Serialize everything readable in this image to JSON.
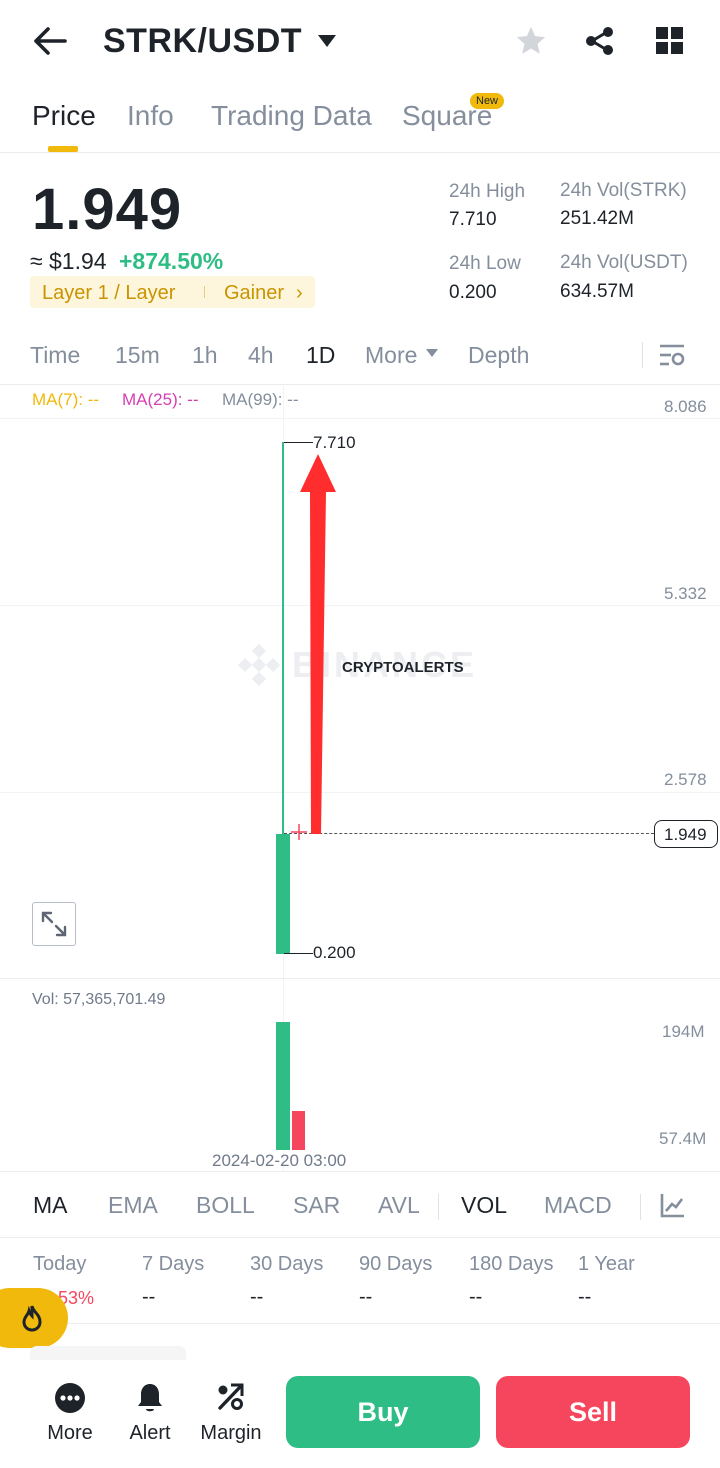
{
  "header": {
    "title": "STRK/USDT"
  },
  "tabs": [
    {
      "label": "Price"
    },
    {
      "label": "Info"
    },
    {
      "label": "Trading Data"
    },
    {
      "label": "Square"
    }
  ],
  "new_badge": "New",
  "price": {
    "last": "1.949",
    "usd_approx": "≈ $1.94",
    "change": "+874.50%",
    "tag_category": "Layer 1 / Layer",
    "tag_status": "Gainer",
    "chevron": "›"
  },
  "stats": {
    "high_label": "24h High",
    "high": "7.710",
    "low_label": "24h Low",
    "low": "0.200",
    "vol_base_label": "24h Vol(STRK)",
    "vol_base": "251.42M",
    "vol_quote_label": "24h Vol(USDT)",
    "vol_quote": "634.57M"
  },
  "intervals": [
    {
      "label": "Time"
    },
    {
      "label": "15m"
    },
    {
      "label": "1h"
    },
    {
      "label": "4h"
    },
    {
      "label": "1D"
    },
    {
      "label": "More"
    },
    {
      "label": "Depth"
    }
  ],
  "ma": {
    "ma7": "MA(7): --",
    "ma25": "MA(25): --",
    "ma99": "MA(99): --"
  },
  "chart": {
    "watermark": "BINANCE",
    "overlay_text": "CRYPTOALERTS",
    "high_label": "7.710",
    "low_label": "0.200",
    "current_label": "1.949",
    "vol_label": "Vol: 57,365,701.49",
    "date_label": "2024-02-20 03:00",
    "price_axis": [
      "8.086",
      "5.332",
      "2.578"
    ],
    "vol_axis": [
      "194M",
      "57.4M"
    ]
  },
  "chart_data": {
    "type": "candlestick",
    "x": [
      "2024-02-20 03:00"
    ],
    "open": 0.2,
    "high": 7.71,
    "low": 0.2,
    "close": 1.949,
    "price_ticks": [
      8.086,
      5.332,
      2.578
    ],
    "volume": [
      {
        "name": "green bar",
        "value": 194000000
      },
      {
        "name": "red bar",
        "value": 57400000
      }
    ],
    "volume_ticks": [
      "194M",
      "57.4M"
    ],
    "colors": {
      "up": "#2ebd85",
      "down": "#f6465d",
      "arrow": "#ff2d2d"
    }
  },
  "indicators": [
    {
      "label": "MA"
    },
    {
      "label": "EMA"
    },
    {
      "label": "BOLL"
    },
    {
      "label": "SAR"
    },
    {
      "label": "AVL"
    },
    {
      "label": "VOL"
    },
    {
      "label": "MACD"
    }
  ],
  "periods": [
    {
      "label": "Today",
      "value": "53%"
    },
    {
      "label": "7 Days",
      "value": "--"
    },
    {
      "label": "30 Days",
      "value": "--"
    },
    {
      "label": "90 Days",
      "value": "--"
    },
    {
      "label": "180 Days",
      "value": "--"
    },
    {
      "label": "1 Year",
      "value": "--"
    }
  ],
  "bottom": {
    "more": "More",
    "alert": "Alert",
    "margin": "Margin",
    "buy": "Buy",
    "sell": "Sell"
  },
  "colors": {
    "accent": "#f0b90b",
    "up": "#2ebd85",
    "down": "#f6465d",
    "ma7": "#f0b90b",
    "ma25": "#d63fb3",
    "ma99": "#848e9c"
  }
}
